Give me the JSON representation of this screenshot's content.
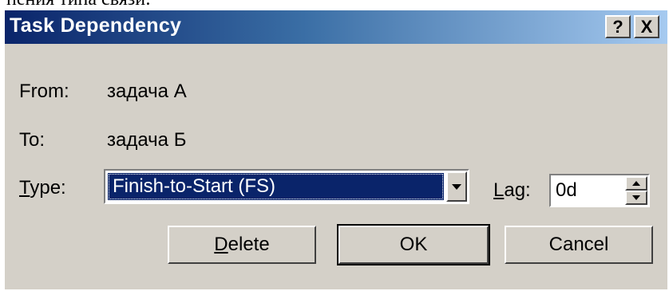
{
  "background_text": "пения типа связи:",
  "dialog": {
    "title": "Task Dependency",
    "help_button": "?",
    "close_button": "X"
  },
  "fields": {
    "from_label": "From:",
    "from_value": "задача А",
    "to_label": "To:",
    "to_value": "задача Б",
    "type_label_mnemonic": "T",
    "type_label_rest": "ype:",
    "type_selected": "Finish-to-Start (FS)",
    "lag_label_mnemonic": "L",
    "lag_label_rest": "ag:",
    "lag_value": "0d"
  },
  "buttons": {
    "delete_mnemonic": "D",
    "delete_rest": "elete",
    "ok": "OK",
    "cancel": "Cancel"
  },
  "icons": {
    "combo_arrow": "chevron-down-icon",
    "spin_up": "spin-up-icon",
    "spin_down": "spin-down-icon"
  },
  "colors": {
    "titlebar_start": "#0a246a",
    "titlebar_end": "#a6caf0",
    "dialog_face": "#d4d0c8",
    "selection": "#0a246a"
  }
}
